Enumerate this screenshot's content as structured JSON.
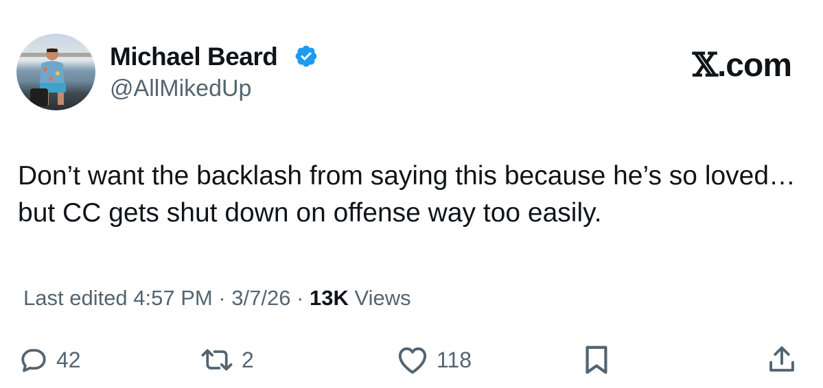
{
  "author": {
    "name": "Michael Beard",
    "handle": "@AllMikedUp",
    "verified": true
  },
  "brand": {
    "label": "X.com",
    "glyph": "𝕏",
    "suffix": ".com"
  },
  "tweet": {
    "text": "Don’t want the backlash from saying this because he’s so loved… but CC gets shut down on offense way too easily."
  },
  "meta": {
    "edited_label": "Last edited 4:57 PM · 3/7/26 ·",
    "views_count": "13K",
    "views_label": "Views"
  },
  "actions": {
    "replies": "42",
    "reposts": "2",
    "likes": "118",
    "icons": [
      "reply-icon",
      "repost-icon",
      "like-icon",
      "bookmark-icon",
      "share-icon"
    ]
  },
  "colors": {
    "verified_blue": "#1d9bf0",
    "secondary_text": "#536471",
    "primary_text": "#0f1419"
  }
}
